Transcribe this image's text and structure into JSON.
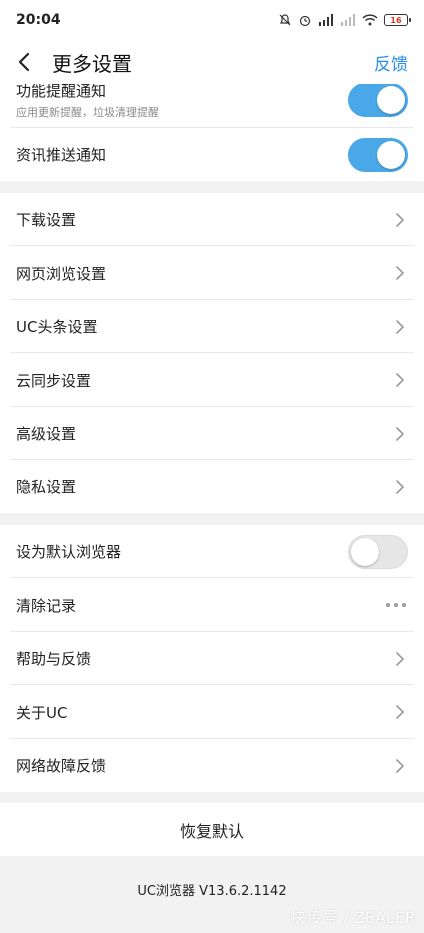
{
  "status_bar": {
    "time": "20:04",
    "battery": "16"
  },
  "header": {
    "title": "更多设置",
    "action": "反馈"
  },
  "notifications": {
    "feature_reminder": {
      "label": "功能提醒通知",
      "sublabel": "应用更新提醒，垃圾清理提醒",
      "enabled": true
    },
    "news_push": {
      "label": "资讯推送通知",
      "enabled": true
    }
  },
  "settings_menu": [
    {
      "label": "下载设置"
    },
    {
      "label": "网页浏览设置"
    },
    {
      "label": "UC头条设置"
    },
    {
      "label": "云同步设置"
    },
    {
      "label": "高级设置"
    },
    {
      "label": "隐私设置"
    }
  ],
  "misc": {
    "default_browser": {
      "label": "设为默认浏览器",
      "enabled": false
    },
    "clear_records": {
      "label": "清除记录"
    },
    "help": {
      "label": "帮助与反馈"
    },
    "about": {
      "label": "关于UC"
    },
    "network_feedback": {
      "label": "网络故障反馈"
    }
  },
  "restore_default": "恢复默认",
  "version": "UC浏览器 V13.6.2.1142",
  "watermark": "快传号 / ZEALER",
  "colors": {
    "accent": "#2a8ee6",
    "toggle_on": "#4aa8e8"
  }
}
